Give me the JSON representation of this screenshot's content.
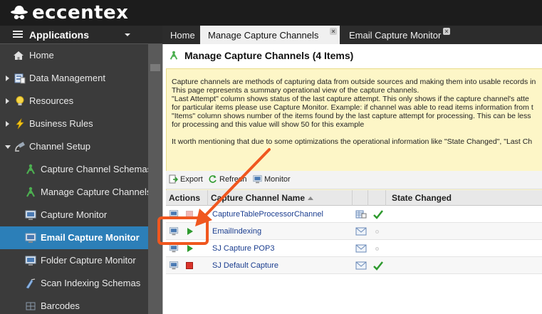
{
  "brand": {
    "name": "eccentex"
  },
  "sidebar": {
    "header": "Applications",
    "items": [
      {
        "label": "Home",
        "icon": "house-icon",
        "level": 0
      },
      {
        "label": "Data Management",
        "icon": "database-icon",
        "level": 0,
        "expander": "collapsed"
      },
      {
        "label": "Resources",
        "icon": "lightbulb-icon",
        "level": 0,
        "expander": "collapsed"
      },
      {
        "label": "Business Rules",
        "icon": "lightning-icon",
        "level": 0,
        "expander": "collapsed"
      },
      {
        "label": "Channel Setup",
        "icon": "satellite-icon",
        "level": 0,
        "expander": "expanded"
      },
      {
        "label": "Capture Channel Schemas",
        "icon": "channel-icon",
        "level": 1
      },
      {
        "label": "Manage Capture Channels",
        "icon": "channel-icon",
        "level": 1
      },
      {
        "label": "Capture Monitor",
        "icon": "monitor-icon",
        "level": 1
      },
      {
        "label": "Email Capture Monitor",
        "icon": "monitor-icon",
        "level": 1,
        "active": true
      },
      {
        "label": "Folder Capture Monitor",
        "icon": "monitor-icon",
        "level": 1
      },
      {
        "label": "Scan Indexing Schemas",
        "icon": "scan-icon",
        "level": 1
      },
      {
        "label": "Barcodes",
        "icon": "barcode-icon",
        "level": 1
      }
    ]
  },
  "tabs": [
    {
      "label": "Home",
      "active": false,
      "closable": false
    },
    {
      "label": "Manage Capture Channels",
      "active": true,
      "closable": true
    },
    {
      "label": "Email Capture Monitor",
      "active": false,
      "closable": true
    }
  ],
  "main": {
    "title": "Manage Capture Channels (4 Items)",
    "info_lines": [
      "Capture channels are methods of capturing data from outside sources and making them into usable records in",
      "This page represents a summary operational view of the capture channels.",
      "\"Last Attempt\" column shows status of the last capture attempt. This only shows if the capture channel's atte",
      "for particular items please use Capture Monitor. Example: if channel was able to read items information from t",
      "\"Items\" column shows number of the items found by the last capture attempt for processing. This can be less",
      "for processing and this value will show 50 for this example",
      "",
      "It worth mentioning that due to some optimizations the operational information like \"State Changed\", \"Last Ch"
    ],
    "toolbar": {
      "export": "Export",
      "refresh": "Refresh",
      "monitor": "Monitor"
    },
    "grid": {
      "columns": {
        "actions": "Actions",
        "name": "Capture Channel Name",
        "state_changed": "State Changed"
      },
      "rows": [
        {
          "name": "CaptureTableProcessorChannel",
          "action": "stop",
          "type_icon": "table-icon",
          "status": "check"
        },
        {
          "name": "EmailIndexing",
          "action": "play",
          "type_icon": "email-icon",
          "status": "dot"
        },
        {
          "name": "SJ Capture POP3",
          "action": "play",
          "type_icon": "email-icon",
          "status": "dot"
        },
        {
          "name": "SJ Default Capture",
          "action": "stop",
          "type_icon": "email-icon",
          "status": "check"
        }
      ]
    }
  },
  "colors": {
    "accent": "#2c7fb8",
    "annotation": "#f0571f",
    "info_bg": "#fdf6c7",
    "success": "#2e9a2e",
    "stop": "#d9342b"
  }
}
